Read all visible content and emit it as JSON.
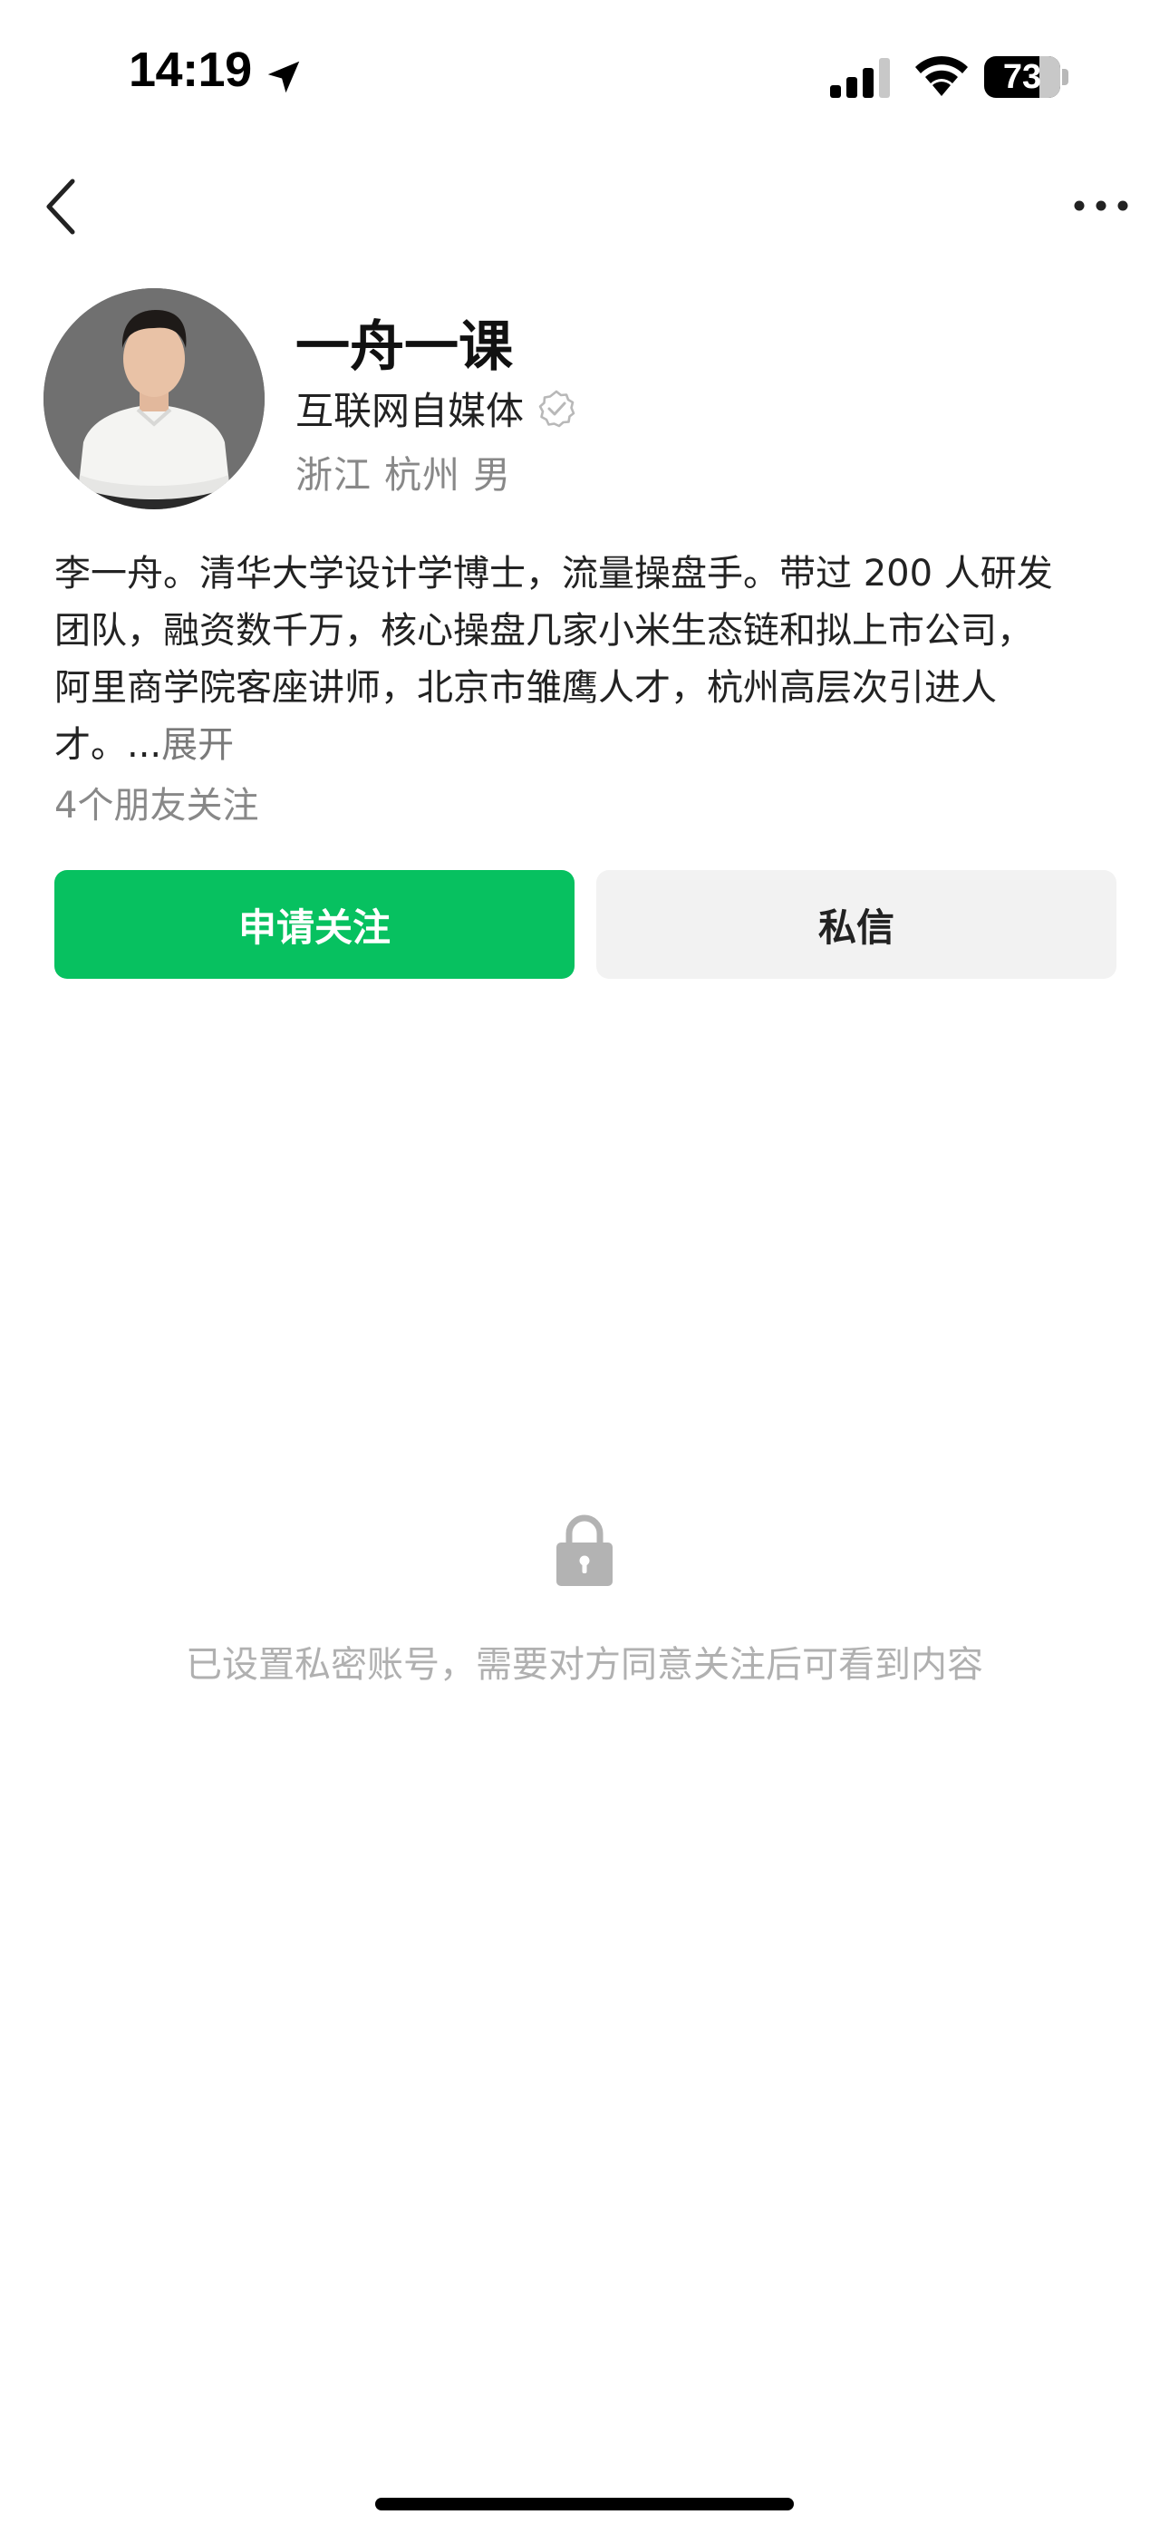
{
  "status_bar": {
    "time": "14:19",
    "battery_level": "73",
    "battery_fraction": 0.73,
    "location_icon": "location-arrow-icon",
    "signal_icon": "cellular-signal-icon",
    "wifi_icon": "wifi-icon"
  },
  "nav": {
    "back_icon": "chevron-left-icon",
    "more_icon": "more-dots-icon"
  },
  "profile": {
    "name": "一舟一课",
    "title": "互联网自媒体",
    "verified_icon": "verified-badge-icon",
    "location": "浙江 杭州 男"
  },
  "bio": {
    "line1": "李一舟。清华大学设计学博士，流量操盘手。带过 200 人研发",
    "line2": "团队，融资数千万，核心操盘几家小米生态链和拟上市公司，",
    "line3": "阿里商学院客座讲师，北京市雏鹰人才，杭州高层次引进人",
    "line4": "才。...",
    "expand": "展开"
  },
  "friends_follow": "4个朋友关注",
  "actions": {
    "follow_label": "申请关注",
    "message_label": "私信"
  },
  "private": {
    "icon": "lock-icon",
    "notice": "已设置私密账号，需要对方同意关注后可看到内容"
  },
  "colors": {
    "accent": "#07c160",
    "secondary_button": "#f2f2f2",
    "muted_text": "#888888",
    "notice_text": "#b0b0b0"
  }
}
